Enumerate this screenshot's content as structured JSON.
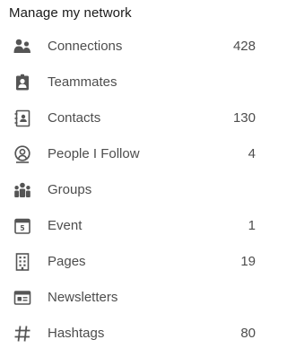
{
  "header": {
    "title": "Manage my network"
  },
  "colors": {
    "icon": "#555555",
    "text": "#4d4d4d",
    "title": "#191919"
  },
  "items": [
    {
      "icon": "connections-icon",
      "label": "Connections",
      "count": "428"
    },
    {
      "icon": "teammates-icon",
      "label": "Teammates",
      "count": ""
    },
    {
      "icon": "contacts-icon",
      "label": "Contacts",
      "count": "130"
    },
    {
      "icon": "people-follow-icon",
      "label": "People I Follow",
      "count": "4"
    },
    {
      "icon": "groups-icon",
      "label": "Groups",
      "count": ""
    },
    {
      "icon": "event-icon",
      "label": "Event",
      "count": "1"
    },
    {
      "icon": "pages-icon",
      "label": "Pages",
      "count": "19"
    },
    {
      "icon": "newsletters-icon",
      "label": "Newsletters",
      "count": ""
    },
    {
      "icon": "hashtag-icon",
      "label": "Hashtags",
      "count": "80"
    }
  ]
}
